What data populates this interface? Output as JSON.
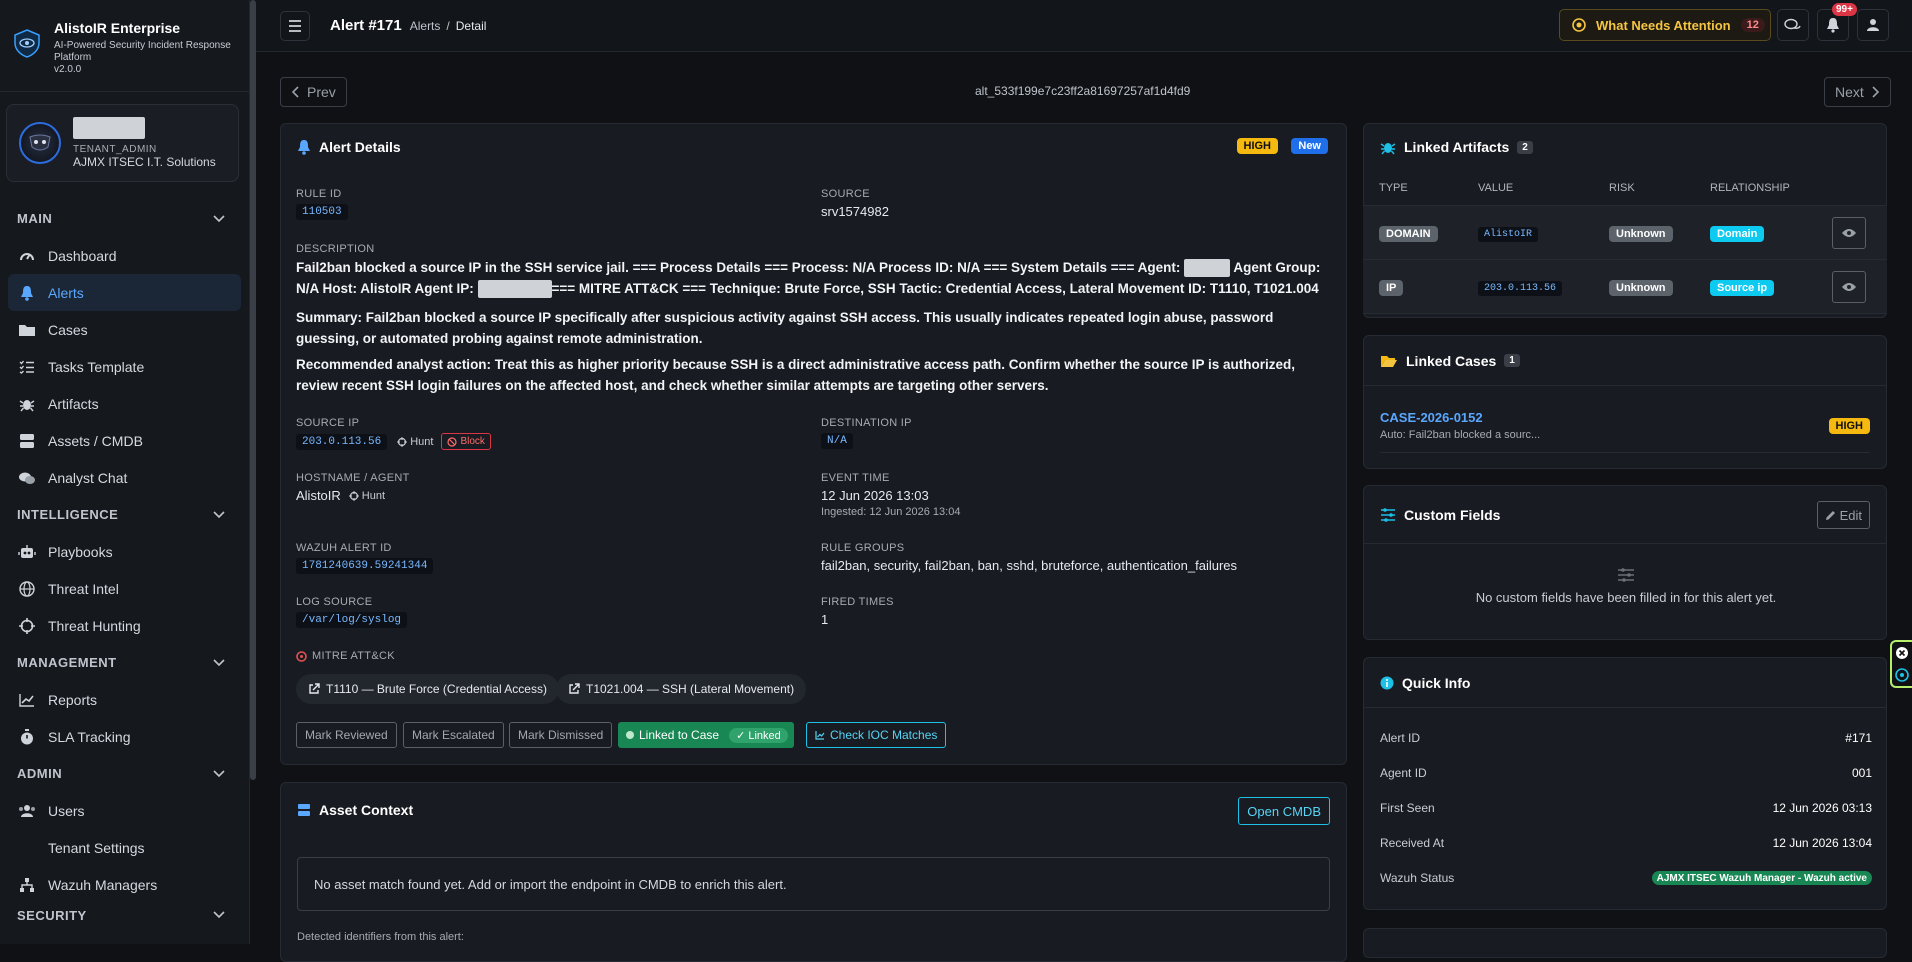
{
  "app": {
    "name": "AlistoIR Enterprise",
    "subtitle": "AI-Powered Security Incident Response Platform",
    "version": "v2.0.0"
  },
  "user": {
    "role": "TENANT_ADMIN",
    "org": "AJMX ITSEC I.T. Solutions"
  },
  "nav": {
    "sections": [
      {
        "title": "MAIN",
        "items": [
          {
            "label": "Dashboard",
            "icon": "gauge-icon"
          },
          {
            "label": "Alerts",
            "icon": "bell-icon",
            "active": true
          },
          {
            "label": "Cases",
            "icon": "folder-icon"
          },
          {
            "label": "Tasks Template",
            "icon": "list-check-icon"
          },
          {
            "label": "Artifacts",
            "icon": "bug-icon"
          },
          {
            "label": "Assets / CMDB",
            "icon": "server-icon"
          },
          {
            "label": "Analyst Chat",
            "icon": "chat-icon"
          }
        ]
      },
      {
        "title": "INTELLIGENCE",
        "items": [
          {
            "label": "Playbooks",
            "icon": "robot-icon"
          },
          {
            "label": "Threat Intel",
            "icon": "globe-icon"
          },
          {
            "label": "Threat Hunting",
            "icon": "crosshair-icon"
          }
        ]
      },
      {
        "title": "MANAGEMENT",
        "items": [
          {
            "label": "Reports",
            "icon": "chart-line-icon"
          },
          {
            "label": "SLA Tracking",
            "icon": "stopwatch-icon"
          }
        ]
      },
      {
        "title": "ADMIN",
        "items": [
          {
            "label": "Users",
            "icon": "users-icon"
          },
          {
            "label": "Tenant Settings",
            "icon": ""
          },
          {
            "label": "Wazuh Managers",
            "icon": "network-icon"
          }
        ]
      },
      {
        "title": "SECURITY",
        "items": []
      }
    ]
  },
  "topbar": {
    "title": "Alert #171",
    "crumb_alerts": "Alerts",
    "crumb_sep": "/",
    "crumb_detail": "Detail",
    "attention_label": "What Needs Attention",
    "attention_count": "12",
    "notif_badge": "99+"
  },
  "pager": {
    "prev": "Prev",
    "next": "Next",
    "alert_uid": "alt_533f199e7c23ff2a81697257af1d4fd9"
  },
  "details": {
    "title": "Alert Details",
    "severity": "HIGH",
    "status": "New",
    "rule_id_label": "RULE ID",
    "rule_id": "110503",
    "source_label": "SOURCE",
    "source": "srv1574982",
    "description_label": "DESCRIPTION",
    "desc_p1a": "Fail2ban blocked a source IP in the SSH service jail. === Process Details === Process: N/A Process ID: N/A === System Details === Agent: ",
    "desc_p1b": " Agent Group: N/A Host: AlistoIR Agent IP: ",
    "desc_p1c": "=== MITRE ATT&CK === Technique: Brute Force, SSH Tactic: Credential Access, Lateral Movement ID: T1110, T1021.004",
    "desc_p2": "Summary: Fail2ban blocked a source IP specifically after suspicious activity against SSH access. This usually indicates repeated login abuse, password guessing, or automated probing against remote administration.",
    "desc_p3": "Recommended analyst action: Treat this as higher priority because SSH is a direct administrative access path. Confirm whether the source IP is authorized, review recent SSH login failures on the affected host, and check whether similar attempts are targeting other servers.",
    "src_ip_label": "SOURCE IP",
    "src_ip": "203.0.113.56",
    "hunt": "Hunt",
    "block": "Block",
    "dst_ip_label": "DESTINATION IP",
    "dst_ip": "N/A",
    "host_label": "HOSTNAME / AGENT",
    "host": "AlistoIR",
    "event_time_label": "EVENT TIME",
    "event_time": "12 Jun 2026 13:03",
    "ingested": "Ingested: 12 Jun 2026 13:04",
    "wazuh_id_label": "WAZUH ALERT ID",
    "wazuh_id": "1781240639.59241344",
    "rule_groups_label": "RULE GROUPS",
    "rule_groups": "fail2ban, security, fail2ban, ban, sshd, bruteforce, authentication_failures",
    "log_source_label": "LOG SOURCE",
    "log_source": "/var/log/syslog",
    "fired_label": "FIRED TIMES",
    "fired": "1",
    "mitre_label": "MITRE ATT&CK",
    "mitre_1": "T1110 — Brute Force (Credential Access)",
    "mitre_2": "T1021.004 — SSH (Lateral Movement)",
    "btn_reviewed": "Mark Reviewed",
    "btn_escalated": "Mark Escalated",
    "btn_dismissed": "Mark Dismissed",
    "linked_case": "Linked to Case",
    "linked": "✓ Linked",
    "check_ioc": "Check IOC Matches"
  },
  "asset": {
    "title": "Asset Context",
    "open_cmdb": "Open CMDB",
    "no_match": "No asset match found yet. Add or import the endpoint in CMDB to enrich this alert.",
    "detected": "Detected identifiers from this alert:"
  },
  "artifacts": {
    "title": "Linked Artifacts",
    "count": "2",
    "cols": [
      "TYPE",
      "VALUE",
      "RISK",
      "RELATIONSHIP"
    ],
    "rows": [
      {
        "type": "DOMAIN",
        "value": "AlistoIR",
        "risk": "Unknown",
        "rel": "Domain"
      },
      {
        "type": "IP",
        "value": "203.0.113.56",
        "risk": "Unknown",
        "rel": "Source ip"
      }
    ]
  },
  "cases": {
    "title": "Linked Cases",
    "count": "1",
    "case_id": "CASE-2026-0152",
    "case_desc": "Auto: Fail2ban blocked a sourc...",
    "severity": "HIGH"
  },
  "custom": {
    "title": "Custom Fields",
    "edit": "Edit",
    "empty": "No custom fields have been filled in for this alert yet."
  },
  "quick": {
    "title": "Quick Info",
    "rows": [
      {
        "k": "Alert ID",
        "v": "#171"
      },
      {
        "k": "Agent ID",
        "v": "001"
      },
      {
        "k": "First Seen",
        "v": "12 Jun 2026 03:13"
      },
      {
        "k": "Received At",
        "v": "12 Jun 2026 13:04"
      },
      {
        "k": "Wazuh Status",
        "v": "AJMX ITSEC Wazuh Manager - Wazuh active"
      }
    ]
  },
  "colors": {
    "accent": "#5aa7ff",
    "high": "#f5b90f",
    "new": "#1f6feb",
    "cyan": "#1ec0e8",
    "green": "#198754"
  }
}
